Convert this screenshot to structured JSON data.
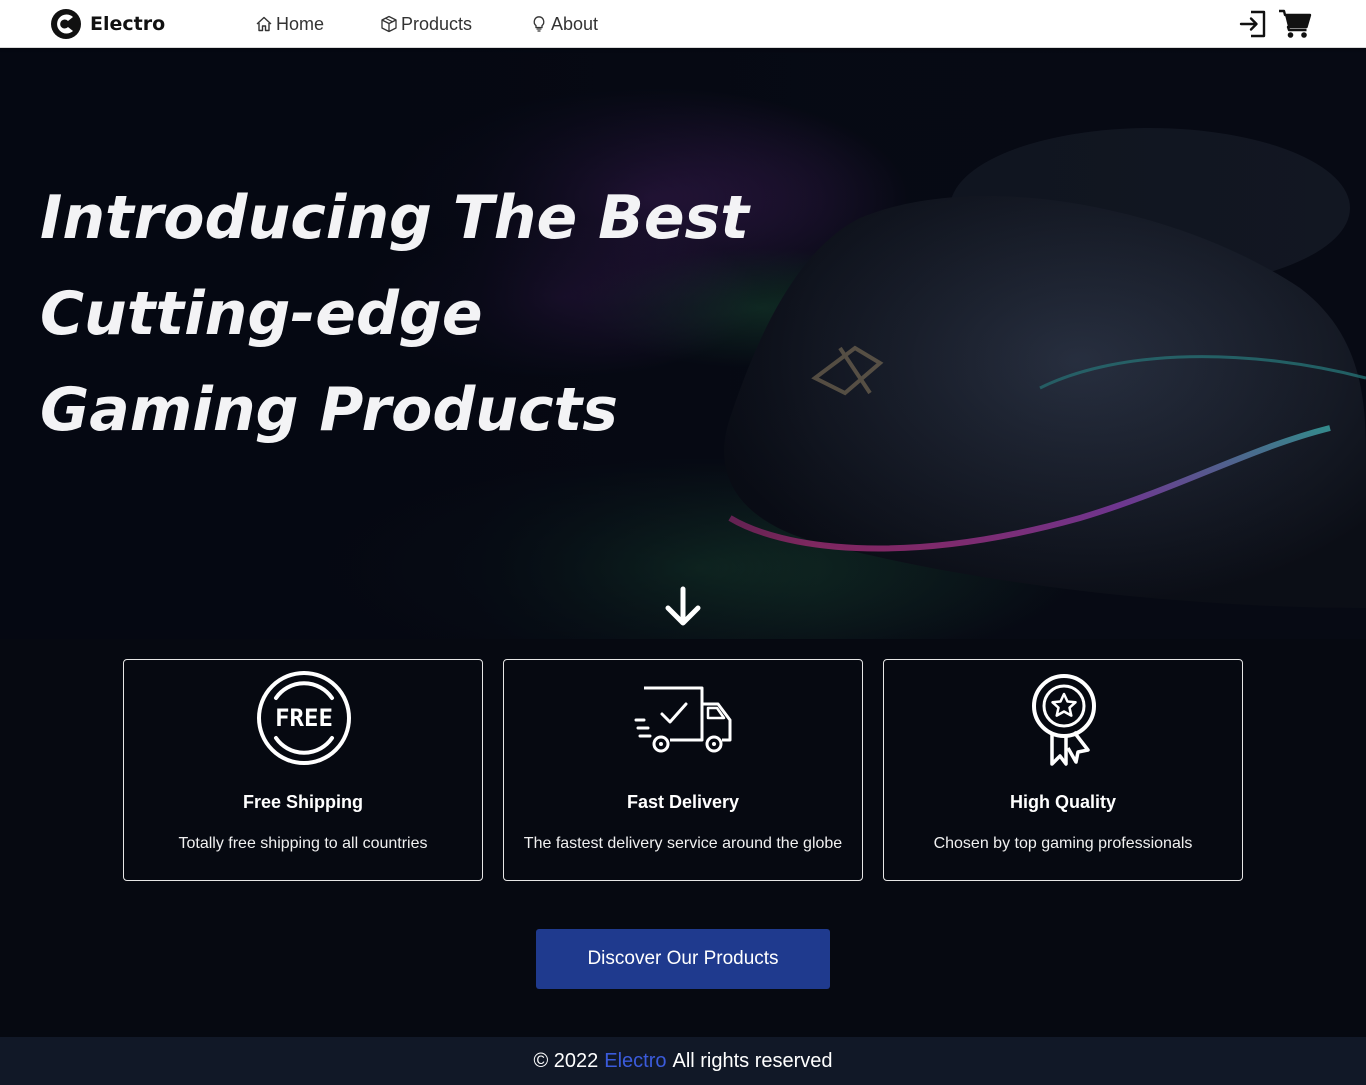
{
  "nav": {
    "brand": "Electro",
    "links": [
      {
        "label": "Home",
        "icon": "home-icon"
      },
      {
        "label": "Products",
        "icon": "box-icon"
      },
      {
        "label": "About",
        "icon": "lightbulb-icon"
      }
    ],
    "actions": [
      {
        "icon": "login-icon"
      },
      {
        "icon": "cart-icon"
      }
    ]
  },
  "hero": {
    "title_lines": [
      "Introducing The Best",
      "Cutting-edge",
      "Gaming Products"
    ],
    "scroll_icon": "arrow-down-icon"
  },
  "features": [
    {
      "icon": "free-badge-icon",
      "badge_text": "FREE",
      "title": "Free Shipping",
      "text": "Totally free shipping to all countries"
    },
    {
      "icon": "delivery-truck-icon",
      "title": "Fast Delivery",
      "text": "The fastest delivery service around the globe"
    },
    {
      "icon": "award-ribbon-icon",
      "title": "High Quality",
      "text": "Chosen by top gaming professionals"
    }
  ],
  "cta": {
    "label": "Discover Our Products"
  },
  "footer": {
    "prefix": "© 2022",
    "brand": "Electro",
    "suffix": "All rights reserved"
  },
  "colors": {
    "background": "#060911",
    "footer_bg": "#111827",
    "cta_bg": "#1f3a8e",
    "brand_link": "#3b5bdb"
  }
}
